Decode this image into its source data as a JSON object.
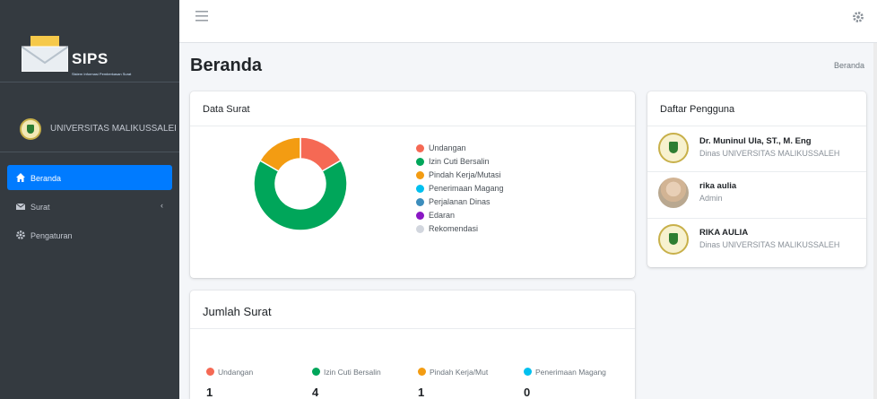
{
  "brand": {
    "name": "SIPS",
    "subtitle": "Sistem Informasi Pemberkasan Surat"
  },
  "sidebar": {
    "institution": "UNIVERSITAS MALIKUSSALEH",
    "items": [
      {
        "label": "Beranda",
        "icon": "home-icon",
        "active": true
      },
      {
        "label": "Surat",
        "icon": "envelope-icon",
        "caret": "‹"
      },
      {
        "label": "Pengaturan",
        "icon": "gear-icon"
      }
    ]
  },
  "header": {
    "title": "Beranda",
    "breadcrumb": "Beranda"
  },
  "data_surat": {
    "title": "Data Surat",
    "legend": [
      {
        "label": "Undangan",
        "color": "#f56954"
      },
      {
        "label": "Izin Cuti Bersalin",
        "color": "#00a65a"
      },
      {
        "label": "Pindah Kerja/Mutasi",
        "color": "#f39c12"
      },
      {
        "label": "Penerimaan Magang",
        "color": "#00c0ef"
      },
      {
        "label": "Perjalanan Dinas",
        "color": "#3c8dbc"
      },
      {
        "label": "Edaran",
        "color": "#8a17c4"
      },
      {
        "label": "Rekomendasi",
        "color": "#d2d6de"
      }
    ],
    "values": [
      1,
      4,
      1,
      0,
      0,
      0,
      0
    ]
  },
  "pengguna": {
    "title": "Daftar Pengguna",
    "users": [
      {
        "name": "Dr. Muninul Ula, ST., M. Eng",
        "role": "Dinas UNIVERSITAS MALIKUSSALEH",
        "avatar": "university-logo"
      },
      {
        "name": "rika aulia",
        "role": "Admin",
        "avatar": "photo"
      },
      {
        "name": "RIKA AULIA",
        "role": "Dinas UNIVERSITAS MALIKUSSALEH",
        "avatar": "university-logo"
      }
    ]
  },
  "jumlah_surat": {
    "title": "Jumlah Surat",
    "stats": [
      {
        "label": "Undangan",
        "value": "1",
        "color": "#f56954"
      },
      {
        "label": "Izin Cuti Bersalin",
        "value": "4",
        "color": "#00a65a"
      },
      {
        "label": "Pindah Kerja/Mut",
        "value": "1",
        "color": "#f39c12"
      },
      {
        "label": "Penerimaan Magang",
        "value": "0",
        "color": "#00c0ef"
      }
    ]
  }
}
